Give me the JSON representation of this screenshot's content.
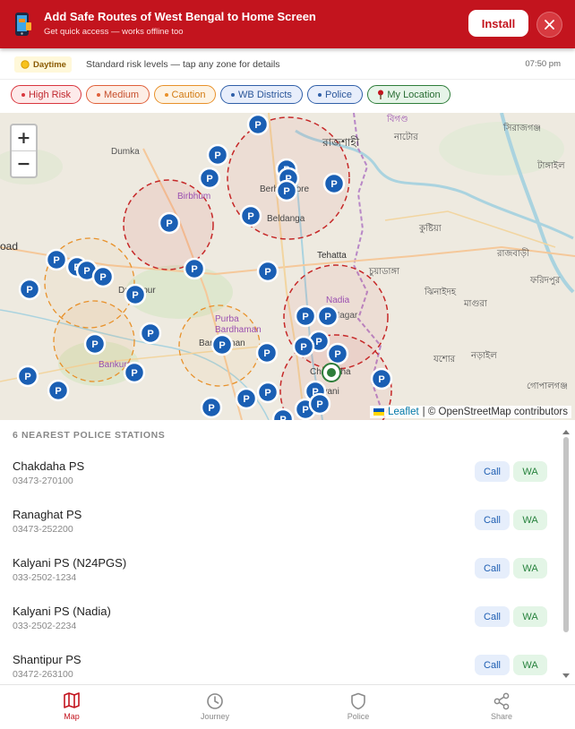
{
  "banner": {
    "title": "Add Safe Routes of West Bengal to Home Screen",
    "subtitle": "Get quick access — works offline too",
    "install_label": "Install",
    "close_icon": "close-icon",
    "app_icon": "phone-app-icon",
    "accent": "#c3141e"
  },
  "status": {
    "badge_label": "Daytime",
    "badge_icon": "sun-icon",
    "text": "Standard risk levels — tap any zone for details",
    "time": "07:50 pm"
  },
  "filters": [
    {
      "label": "High Risk",
      "color": "#d9363e",
      "has_dot": true
    },
    {
      "label": "Medium",
      "color": "#e0603a",
      "has_dot": true
    },
    {
      "label": "Caution",
      "color": "#e8912a",
      "has_dot": true
    },
    {
      "label": "WB Districts",
      "color": "#2f5fa8",
      "has_dot": true
    },
    {
      "label": "Police",
      "color": "#2f5fa8",
      "has_dot": true
    },
    {
      "label": "My Location",
      "color": "#2e7d3a",
      "has_dot": false,
      "icon": "pin-icon"
    }
  ],
  "map": {
    "zoom_in": "+",
    "zoom_out": "−",
    "attribution_leaflet": "Leaflet",
    "attribution_rest": "| © OpenStreetMap contributors",
    "places": [
      "Dumka",
      "রাজশাহী",
      "নাটোর",
      "সিরাজগঞ্জ",
      "টাঙ্গাইল",
      "বিগণ্ড",
      "Berhampore",
      "Beldanga",
      "কুষ্টিয়া",
      "রাজবাড়ী",
      "Tehatta",
      "চুয়াডাঙ্গা",
      "ঝিনাইদহ",
      "ফরিদপুর",
      "মাগুরা",
      "Nadia",
      "Nagar",
      "Birbhum",
      "Durgapur",
      "Purba Bardhaman",
      "Bankura",
      "Bardhaman",
      "যশোর",
      "নড়াইল",
      "গোপালগঞ্জ",
      "Chakdaha",
      "Kalyani",
      "oad"
    ]
  },
  "list": {
    "header": "6 NEAREST POLICE STATIONS",
    "call_label": "Call",
    "wa_label": "WA",
    "items": [
      {
        "name": "Chakdaha PS",
        "phone": "03473-270100"
      },
      {
        "name": "Ranaghat PS",
        "phone": "03473-252200"
      },
      {
        "name": "Kalyani PS (N24PGS)",
        "phone": "033-2502-1234"
      },
      {
        "name": "Kalyani PS (Nadia)",
        "phone": "033-2502-2234"
      },
      {
        "name": "Shantipur PS",
        "phone": "03472-263100"
      }
    ]
  },
  "nav": [
    {
      "label": "Map",
      "icon": "map-icon",
      "active": true
    },
    {
      "label": "Journey",
      "icon": "clock-icon",
      "active": false
    },
    {
      "label": "Police",
      "icon": "shield-icon",
      "active": false
    },
    {
      "label": "Share",
      "icon": "share-icon",
      "active": false
    }
  ]
}
